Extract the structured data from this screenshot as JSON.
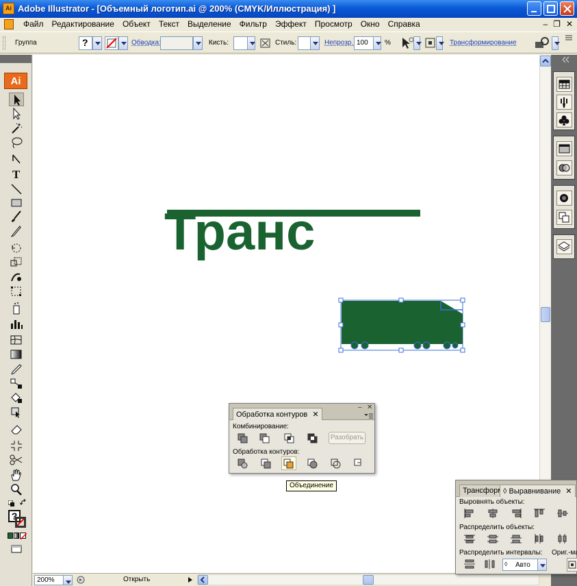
{
  "window": {
    "title": "Adobe Illustrator - [Объемный логотип.ai @ 200% (CMYK/Иллюстрация) ]",
    "app_icon": "Ai"
  },
  "menubar": {
    "items": [
      "Файл",
      "Редактирование",
      "Объект",
      "Текст",
      "Выделение",
      "Фильтр",
      "Эффект",
      "Просмотр",
      "Окно",
      "Справка"
    ]
  },
  "controlbar": {
    "selection_label": "Группа",
    "stroke_label": "Обводка:",
    "brush_label": "Кисть:",
    "style_label": "Стиль:",
    "opacity_label": "Непрозр.:",
    "opacity_value": "100",
    "opacity_unit": "%",
    "transform_label": "Трансформирование"
  },
  "tools": {
    "logo": "Ai"
  },
  "canvas": {
    "logo_text": "Транс",
    "logo_color": "#1a6230",
    "selection_color": "#3a6fd8"
  },
  "statusbar": {
    "zoom": "200%",
    "status_text": "Открыть"
  },
  "pathfinder_panel": {
    "tab_label": "Обработка контуров",
    "combine_label": "Комбинирование:",
    "expand_button": "Разобрать",
    "pathfinders_label": "Обработка контуров:"
  },
  "tooltip": {
    "text": "Объединение"
  },
  "align_panel": {
    "tab_transform": "Трансформ",
    "tab_align": "Выравнивание",
    "align_objects_label": "Выровнять объекты:",
    "distribute_objects_label": "Распределить объекты:",
    "distribute_spacing_label": "Распределить интервалы:",
    "align_to_label": "Ориг.-ма",
    "spacing_value": "Авто"
  }
}
